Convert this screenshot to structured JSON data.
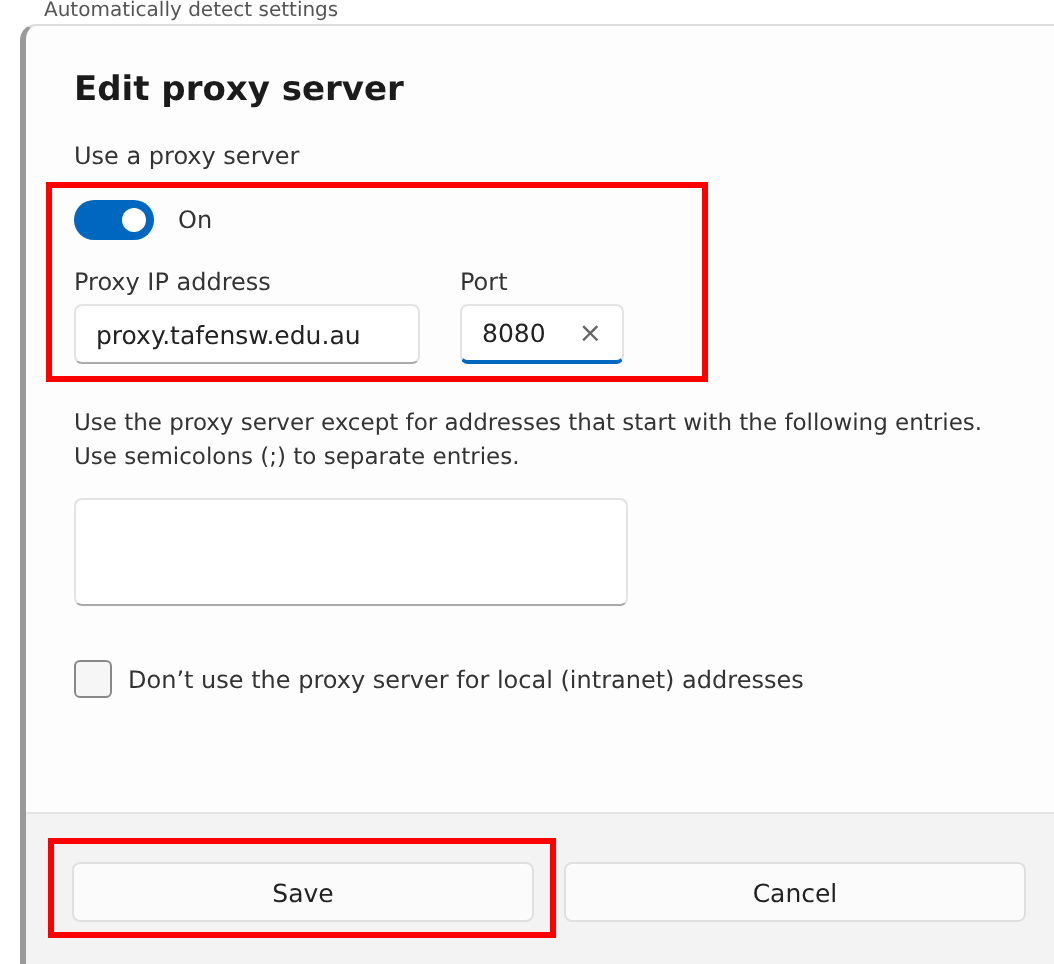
{
  "background": {
    "setting_label": "Automatically detect settings"
  },
  "dialog": {
    "title": "Edit proxy server",
    "proxy_section": {
      "highlighted": true,
      "label": "Use a proxy server",
      "toggle": {
        "on": true,
        "label": "On"
      },
      "address": {
        "label": "Proxy IP address",
        "value": "proxy.tafensw.edu.au"
      },
      "port": {
        "label": "Port",
        "value": "8080",
        "focused": true,
        "clear": "×"
      }
    },
    "exceptions": {
      "description": "Use the proxy server except for addresses that start with the following entries. Use semicolons (;) to separate entries."
    },
    "local_checkbox": {
      "label": "Don’t use the proxy server for local (intranet) addresses",
      "checked": false
    },
    "buttons": [
      {
        "label": "Save",
        "highlighted": true
      },
      {
        "label": "Cancel",
        "highlighted": false
      }
    ]
  }
}
